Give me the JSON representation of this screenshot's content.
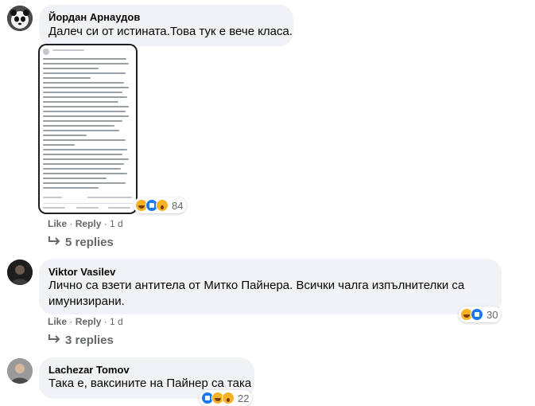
{
  "comments": [
    {
      "author": "Йордан Арнаудов",
      "text": "Далеч си от истината.Това тук е вече класа.",
      "actions": {
        "like": "Like",
        "sep": " · ",
        "reply": "Reply",
        "time": "1 d"
      },
      "reactions": {
        "icons": [
          "haha-icon",
          "like-icon",
          "wow-icon"
        ],
        "count": "84"
      },
      "replies": "5 replies"
    },
    {
      "author": "Viktor Vasilev",
      "text_line1": "Лично са взети антитела от Митко Пайнера. Всички чалга изпълнителки са",
      "text_line2": "имунизирани.",
      "actions": {
        "like": "Like",
        "sep": " · ",
        "reply": "Reply",
        "time": "1 d"
      },
      "reactions": {
        "icons": [
          "haha-icon",
          "like-icon"
        ],
        "count": "30"
      },
      "replies": "3 replies"
    },
    {
      "author": "Lachezar Tomov",
      "text": "Така е, ваксините на Пайнер са така",
      "reactions": {
        "icons": [
          "like-icon",
          "haha-icon",
          "wow-icon"
        ],
        "count": "22"
      }
    }
  ],
  "colors": {
    "bubble": "#f0f2f5",
    "meta": "#65676b",
    "like": "#1877f2",
    "haha": "#f7b125"
  }
}
